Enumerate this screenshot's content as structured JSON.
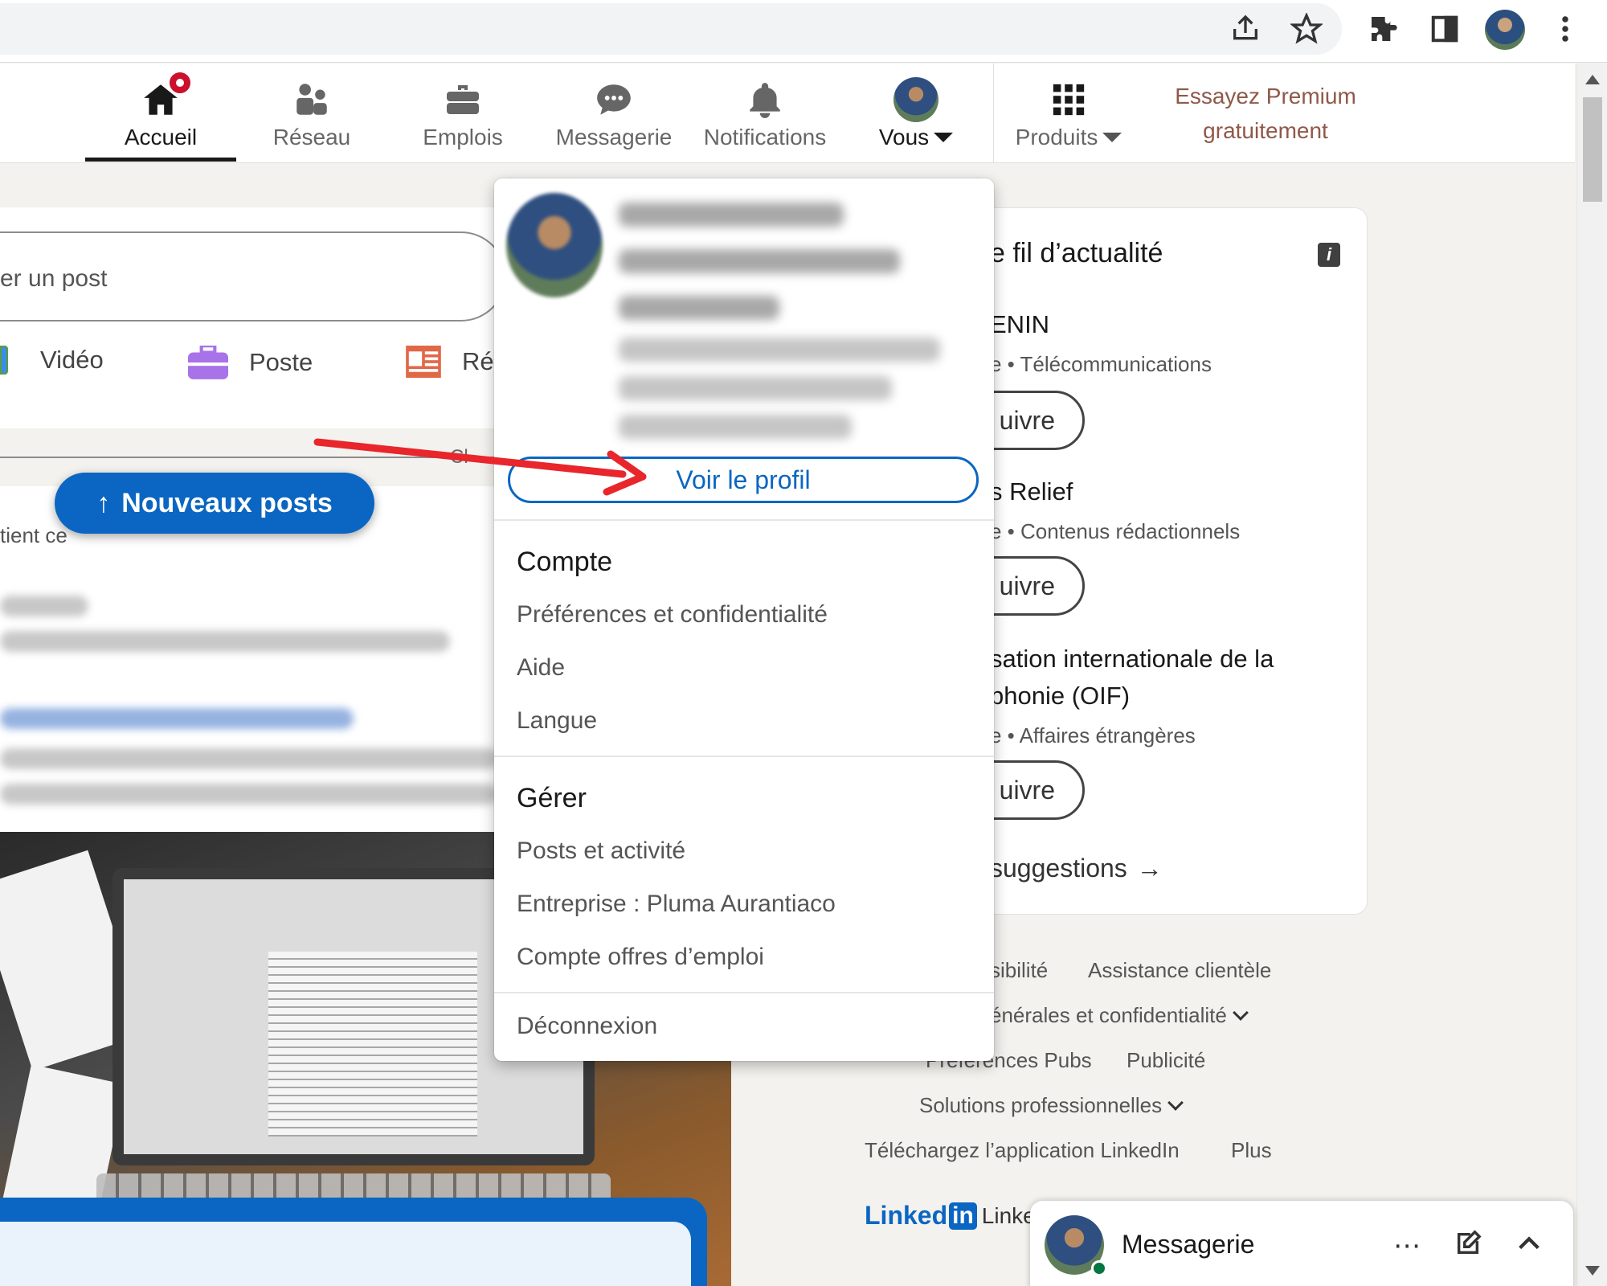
{
  "nav": {
    "items": [
      {
        "label": "Accueil",
        "icon": "home-icon"
      },
      {
        "label": "Réseau",
        "icon": "network-icon"
      },
      {
        "label": "Emplois",
        "icon": "briefcase-icon"
      },
      {
        "label": "Messagerie",
        "icon": "message-icon"
      },
      {
        "label": "Notifications",
        "icon": "bell-icon"
      },
      {
        "label": "Vous",
        "icon": "avatar"
      },
      {
        "label": "Produits",
        "icon": "grid-icon"
      }
    ],
    "premium_line1": "Essayez Premium",
    "premium_line2": "gratuitement"
  },
  "composer": {
    "placeholder": "er un post",
    "video_label": "Vidéo",
    "job_label": "Poste",
    "article_label": "Ré"
  },
  "feed": {
    "sort_text": "Cl",
    "new_posts": "Nouveaux posts",
    "post_preview": "tient ce"
  },
  "dropdown": {
    "view_profile": "Voir le profil",
    "account_heading": "Compte",
    "account_items": [
      "Préférences et confidentialité",
      "Aide",
      "Langue"
    ],
    "manage_heading": "Gérer",
    "manage_items": [
      "Posts et activité",
      "Entreprise : Pluma Aurantiaco",
      "Compte offres d’emploi"
    ],
    "logout": "Déconnexion"
  },
  "suggestions": {
    "title": "e fil d’actualité",
    "items": [
      {
        "name": "ENIN",
        "sub": "e • Télécommunications",
        "follow": "uivre"
      },
      {
        "name": "s Relief",
        "sub": "e • Contenus rédactionnels",
        "follow": "uivre"
      },
      {
        "name_line1": "sation internationale de la",
        "name_line2": "phonie (OIF)",
        "sub": "e • Affaires étrangères",
        "follow": "uivre"
      }
    ],
    "more": "suggestions"
  },
  "footer": {
    "accessibility": "sibilité",
    "support": "Assistance clientèle",
    "terms": "énérales et confidentialité",
    "ad_prefs": "Préférences Pubs",
    "advertising": "Publicité",
    "business": "Solutions professionnelles",
    "app": "Téléchargez l’application LinkedIn",
    "more": "Plus",
    "logo_text": "Linked",
    "logo_box": "in",
    "copyright": "Linke"
  },
  "messaging": {
    "title": "Messagerie"
  },
  "colors": {
    "brand_blue": "#0a66c2",
    "notification_red": "#cb112d",
    "premium_brown": "#8f5849",
    "annotation_arrow": "#e8262b"
  }
}
